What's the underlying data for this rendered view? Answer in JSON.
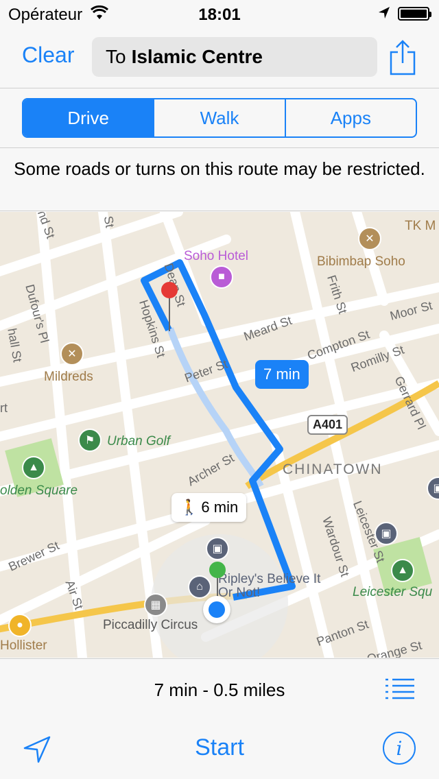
{
  "status_bar": {
    "carrier": "Opérateur",
    "time": "18:01"
  },
  "nav": {
    "clear_label": "Clear",
    "destination_prefix": "To",
    "destination_name": "Islamic Centre"
  },
  "modes": [
    {
      "label": "Drive",
      "active": true
    },
    {
      "label": "Walk",
      "active": false
    },
    {
      "label": "Apps",
      "active": false
    }
  ],
  "warning": "Some roads or turns on this route may be restricted.",
  "map": {
    "drive_eta": "7 min",
    "walk_eta": "6 min",
    "road_badge": "A401",
    "streets": [
      "nd St",
      "St",
      "Dufour's Pl",
      "Hopkins St",
      "Dean St",
      "Meard St",
      "Peter St",
      "Compton St",
      "Frith St",
      "Moor St",
      "Romilly St",
      "Gerrard Pl",
      "Archer St",
      "Wardour St",
      "Leicester St",
      "Brewer St",
      "Air St",
      "Panton St",
      "Orange St",
      "hall St",
      "rt"
    ],
    "pois": [
      "Soho Hotel",
      "Bibimbap Soho",
      "TK M",
      "Mildreds",
      "Urban Golf",
      "olden Square",
      "CHINATOWN",
      "Ripley's Believe It Or Not!",
      "Leicester Squ",
      "Piccadilly Circus",
      "Hollister"
    ]
  },
  "summary": "7 min - 0.5 miles",
  "toolbar": {
    "start_label": "Start"
  },
  "colors": {
    "accent": "#1a82f7",
    "route": "#1a82f7"
  }
}
